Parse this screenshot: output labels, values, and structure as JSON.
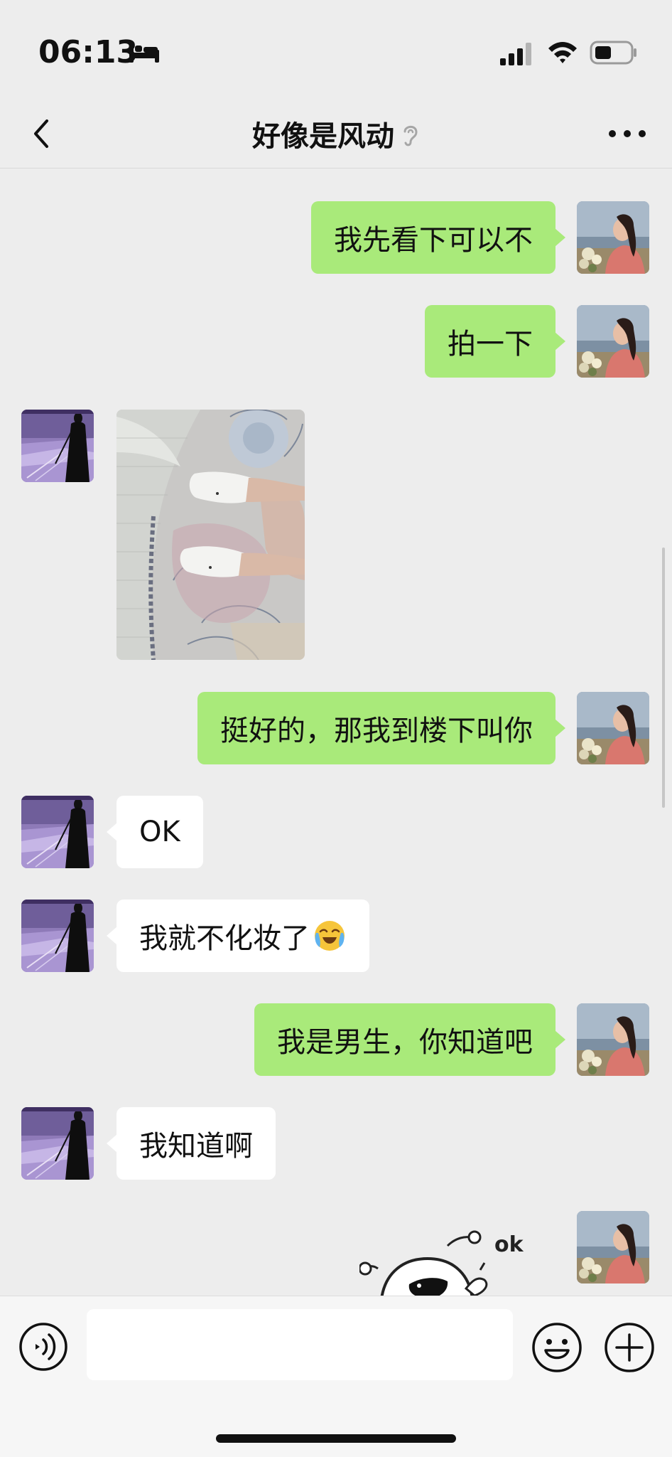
{
  "status_bar": {
    "time": "06:13",
    "focus_mode_icon": "bed-icon",
    "signal_icon": "cellular-signal-icon",
    "wifi_icon": "wifi-icon",
    "battery_icon": "battery-icon"
  },
  "nav": {
    "back_icon": "chevron-left-icon",
    "title": "好像是风动",
    "earpiece_icon": "ear-icon",
    "more_icon": "more-dots-icon"
  },
  "messages": [
    {
      "sender": "self",
      "type": "text",
      "text": "我先看下可以不"
    },
    {
      "sender": "self",
      "type": "text",
      "text": "拍一下"
    },
    {
      "sender": "peer",
      "type": "image"
    },
    {
      "sender": "self",
      "type": "text",
      "text": "挺好的，那我到楼下叫你"
    },
    {
      "sender": "peer",
      "type": "text",
      "text": "OK"
    },
    {
      "sender": "peer",
      "type": "text",
      "text": "我就不化妆了",
      "emoji": "loudly-crying-laughing-emoji"
    },
    {
      "sender": "self",
      "type": "text",
      "text": "我是男生，你知道吧"
    },
    {
      "sender": "peer",
      "type": "text",
      "text": "我知道啊"
    },
    {
      "sender": "self",
      "type": "sticker",
      "sticker_text": "ok"
    }
  ],
  "input_bar": {
    "voice_icon": "voice-icon",
    "input_value": "",
    "emoji_icon": "smiley-icon",
    "plus_icon": "plus-icon"
  },
  "colors": {
    "background": "#ededed",
    "self_bubble": "#a9ea7a",
    "peer_bubble": "#ffffff",
    "input_bar": "#f6f6f6"
  }
}
